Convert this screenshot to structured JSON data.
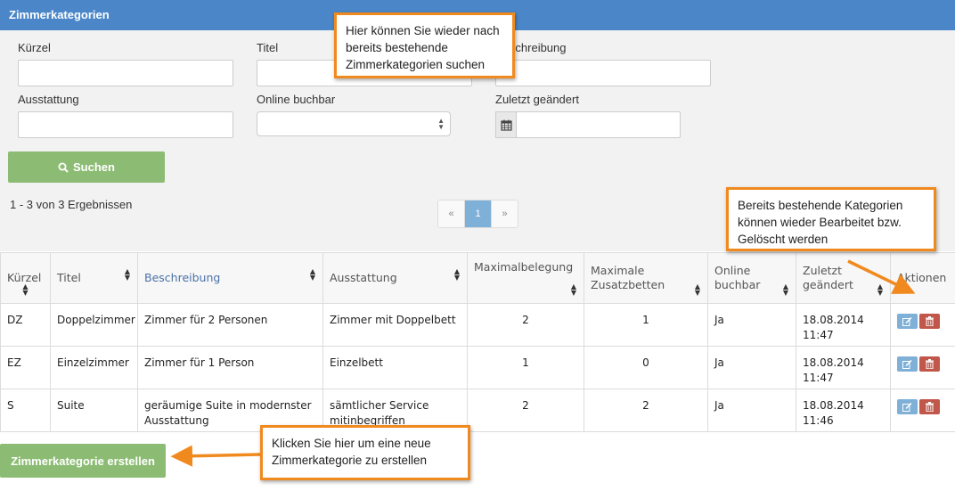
{
  "header": {
    "title": "Zimmerkategorien"
  },
  "filters": {
    "kuerzel_label": "Kürzel",
    "titel_label": "Titel",
    "beschreibung_label": "Beschreibung",
    "ausstattung_label": "Ausstattung",
    "online_label": "Online buchbar",
    "geaendert_label": "Zuletzt geändert",
    "search_button": "Suchen"
  },
  "results_text": "1 - 3 von 3 Ergebnissen",
  "pagination": {
    "prev": "«",
    "current": "1",
    "next": "»"
  },
  "table": {
    "columns": [
      "Kürzel",
      "Titel",
      "Beschreibung",
      "Ausstattung",
      "Maximalbelegung",
      "Maximale Zusatzbetten",
      "Online buchbar",
      "Zuletzt geändert",
      "Aktionen"
    ],
    "rows": [
      {
        "kuerzel": "DZ",
        "titel": "Doppelzimmer",
        "beschreibung": "Zimmer für 2 Personen",
        "ausstattung": "Zimmer mit Doppelbett",
        "maximalbelegung": "2",
        "zusatzbetten": "1",
        "online": "Ja",
        "geaendert_date": "18.08.2014",
        "geaendert_time": "11:47"
      },
      {
        "kuerzel": "EZ",
        "titel": "Einzelzimmer",
        "beschreibung": "Zimmer für 1 Person",
        "ausstattung": "Einzelbett",
        "maximalbelegung": "1",
        "zusatzbetten": "0",
        "online": "Ja",
        "geaendert_date": "18.08.2014",
        "geaendert_time": "11:47"
      },
      {
        "kuerzel": "S",
        "titel": "Suite",
        "beschreibung": "geräumige Suite in modernster Ausstattung",
        "ausstattung": "sämtlicher Service mitinbegriffen",
        "maximalbelegung": "2",
        "zusatzbetten": "2",
        "online": "Ja",
        "geaendert_date": "18.08.2014",
        "geaendert_time": "11:46"
      }
    ]
  },
  "create_button": "Zimmerkategorie erstellen",
  "callouts": {
    "search": "Hier können Sie wieder nach bereits bestehende Zimmerkategorien suchen",
    "edit": "Bereits bestehende Kategorien können wieder Bearbeitet bzw. Gelöscht werden",
    "create": "Klicken Sie hier um eine neue Zimmerkategorie zu erstellen"
  },
  "colors": {
    "header": "#4a86c8",
    "button_green": "#8cbc74",
    "callout_border": "#f08a1e",
    "edit_button": "#7fb0d8",
    "delete_button": "#c0574a"
  }
}
